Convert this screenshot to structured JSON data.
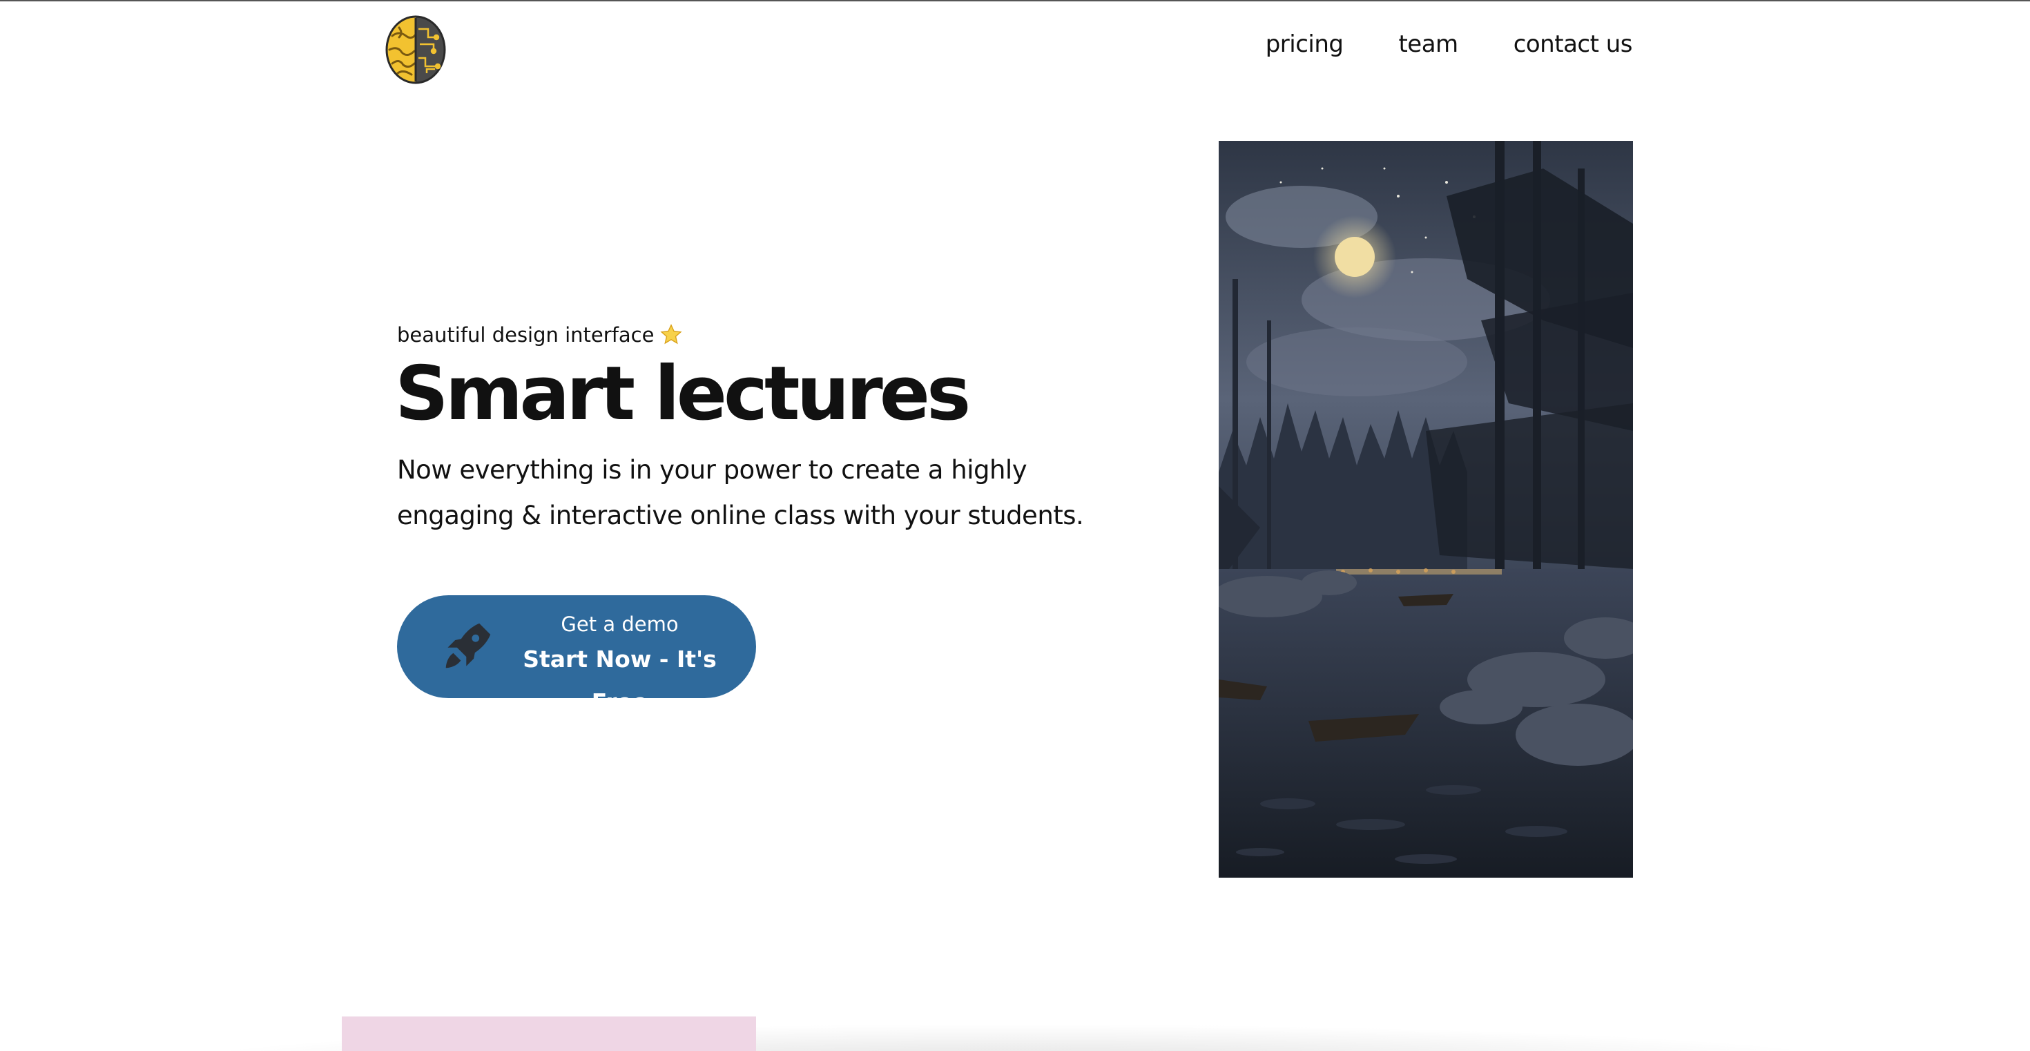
{
  "header": {
    "logo_icon": "brain-icon",
    "nav": [
      {
        "label": "pricing"
      },
      {
        "label": "team"
      },
      {
        "label": "contact us"
      }
    ]
  },
  "hero": {
    "eyebrow": "beautiful design interface",
    "eyebrow_icon": "star-icon",
    "title": "Smart lectures",
    "description": "Now everything is in your power to create a highly engaging & interactive online class with your students.",
    "cta": {
      "icon": "rocket-icon",
      "sub_label": "Get a demo",
      "main_label": "Start Now - It's Free",
      "color": "#2f6a9c"
    },
    "image_icon": "night-lake-illustration"
  },
  "colors": {
    "accent": "#2f6a9c",
    "pink_card": "#efd6e5"
  }
}
